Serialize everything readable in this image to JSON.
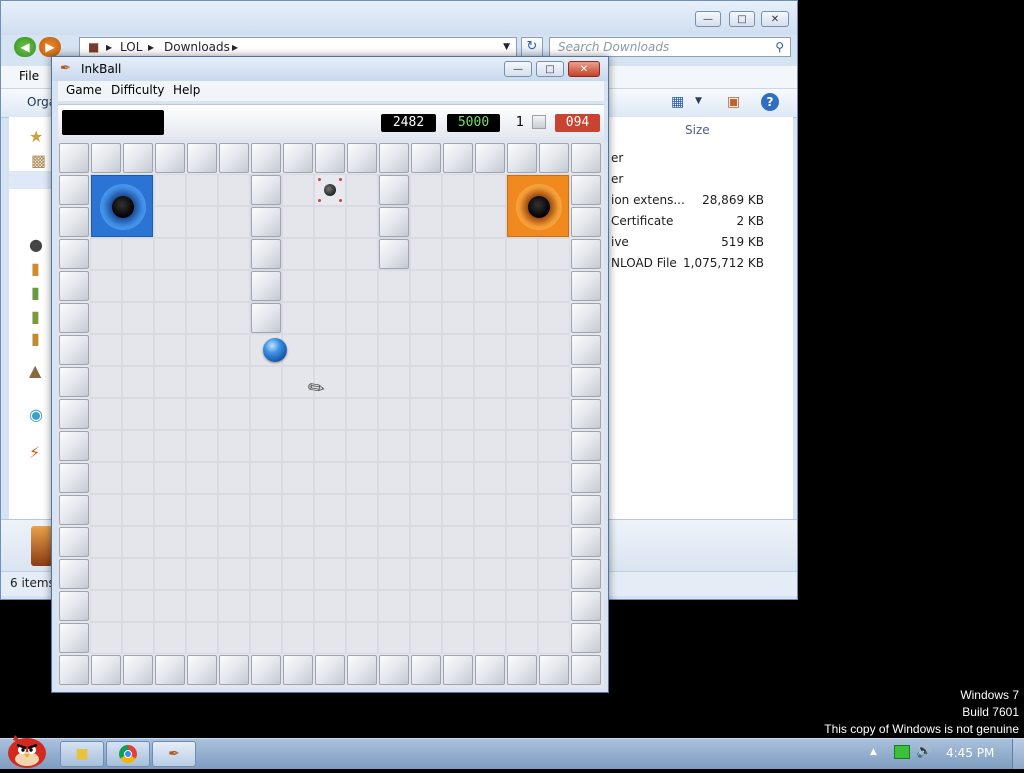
{
  "explorer": {
    "breadcrumb": [
      "LOL",
      "Downloads"
    ],
    "search_placeholder": "Search Downloads",
    "menu_file": "File",
    "toolbar_organize": "Orga",
    "column_size": "Size",
    "files": [
      {
        "name": "er",
        "size": ""
      },
      {
        "name": "er",
        "size": ""
      },
      {
        "name": "ion extens...",
        "size": "28,869 KB"
      },
      {
        "name": "Certificate",
        "size": "2 KB"
      },
      {
        "name": "ive",
        "size": "519 KB"
      },
      {
        "name": "NLOAD File",
        "size": "1,075,712 KB"
      }
    ],
    "status": "6 items"
  },
  "inkball": {
    "title": "InkBall",
    "menu": [
      "Game",
      "Difficulty",
      "Help"
    ],
    "score": "2482",
    "target_score": "5000",
    "level": "1",
    "time": "094",
    "colors": {
      "blue_hole": "#2b74d4",
      "orange_hole": "#f08a1e",
      "ball": "#1f6fcf",
      "time_box": "#c84430",
      "target_text": "#7ddc6a"
    }
  },
  "watermark": {
    "line1": "Windows 7",
    "line2": "Build 7601",
    "line3": "This copy of Windows is not genuine"
  },
  "taskbar": {
    "clock": "4:45 PM",
    "icons": [
      "angry-birds-start-icon",
      "explorer-icon",
      "chrome-icon",
      "inkball-icon"
    ]
  }
}
